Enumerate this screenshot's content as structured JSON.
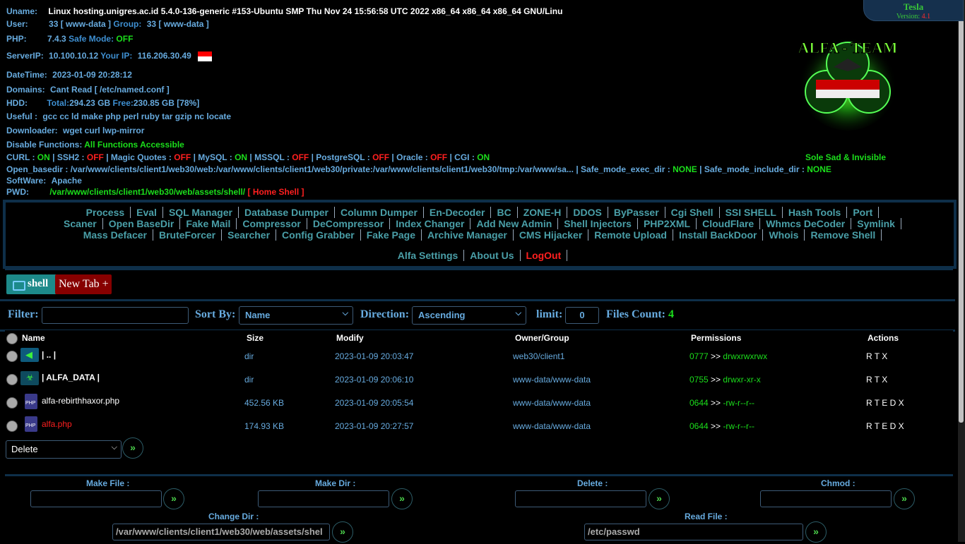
{
  "info": {
    "uname_label": "Uname:",
    "uname": "Linux hosting.unigres.ac.id 5.4.0-136-generic #153-Ubuntu SMP Thu Nov 24 15:56:58 UTC 2022 x86_64 x86_64 x86_64 GNU/Linu",
    "user_label": "User:",
    "user": "33 [ www-data ]",
    "group_label": "Group:",
    "group": "33 [ www-data ]",
    "php_label": "PHP:",
    "php": "7.4.3",
    "safe_mode_label": "Safe Mode:",
    "safe_mode": "OFF",
    "serverip_label": "ServerIP:",
    "serverip": "10.100.10.12",
    "yourip_label": "Your IP:",
    "yourip": "116.206.30.49",
    "datetime_label": "DateTime:",
    "datetime": "2023-01-09 20:28:12",
    "domains_label": "Domains:",
    "domains": "Cant Read [ /etc/named.conf ]",
    "hdd_label": "HDD:",
    "hdd_total_label": "Total:",
    "hdd_total": "294.23 GB",
    "hdd_free_label": "Free:",
    "hdd_free": "230.85 GB [78%]",
    "useful_label": "Useful :",
    "useful": "gcc cc ld make php perl ruby tar gzip nc locate",
    "downloader_label": "Downloader:",
    "downloader": "wget curl lwp-mirror",
    "disable_label": "Disable Functions:",
    "disable": "All Functions Accessible",
    "features": [
      {
        "name": "CURL",
        "state": "ON"
      },
      {
        "name": "SSH2",
        "state": "OFF"
      },
      {
        "name": "Magic Quotes",
        "state": "OFF"
      },
      {
        "name": "MySQL",
        "state": "ON"
      },
      {
        "name": "MSSQL",
        "state": "OFF"
      },
      {
        "name": "PostgreSQL",
        "state": "OFF"
      },
      {
        "name": "Oracle",
        "state": "OFF"
      },
      {
        "name": "CGI",
        "state": "ON"
      }
    ],
    "openbasedir_label": "Open_basedir :",
    "openbasedir": "/var/www/clients/client1/web30/web:/var/www/clients/client1/web30/private:/var/www/clients/client1/web30/tmp:/var/www/sa...",
    "safe_exec_label": "Safe_mode_exec_dir :",
    "safe_exec": "NONE",
    "safe_include_label": "Safe_mode_include_dir :",
    "safe_include": "NONE",
    "software_label": "SoftWare:",
    "software": "Apache",
    "pwd_label": "PWD:",
    "pwd": "/var/www/clients/client1/web30/web/assets/shell/",
    "home_shell": "[ Home Shell ]"
  },
  "badge": {
    "name": "Tesla",
    "version_label": "Version:",
    "version": "4.1"
  },
  "logo_text": "ALFA - TEAM",
  "slogan": "Sole Sad & Invisible",
  "menu": {
    "line1": [
      "Process",
      "Eval",
      "SQL Manager",
      "Database Dumper",
      "Column Dumper",
      "En-Decoder",
      "BC",
      "ZONE-H",
      "DDOS",
      "ByPasser",
      "Cgi Shell",
      "SSI SHELL",
      "Hash Tools",
      "Port"
    ],
    "line2": [
      "Scaner",
      "Open BaseDir",
      "Fake Mail",
      "Compressor",
      "DeCompressor",
      "Index Changer",
      "Add New Admin",
      "Shell Injectors",
      "PHP2XML",
      "CloudFlare",
      "Whmcs DeCoder",
      "Symlink"
    ],
    "line3": [
      "Mass Defacer",
      "BruteForcer",
      "Searcher",
      "Config Grabber",
      "Fake Page",
      "Archive Manager",
      "CMS Hijacker",
      "Remote Upload",
      "Install BackDoor",
      "Whois",
      "Remove Shell"
    ],
    "line4": [
      "Alfa Settings",
      "About Us"
    ],
    "logout": "LogOut"
  },
  "tabs": {
    "current": "shell",
    "new_tab": "New Tab +"
  },
  "filterbar": {
    "filter_label": "Filter:",
    "sort_label": "Sort By:",
    "sort_value": "Name",
    "direction_label": "Direction:",
    "direction_value": "Ascending",
    "limit_label": "limit:",
    "limit_value": "0",
    "count_label": "Files Count:",
    "count": "4"
  },
  "table": {
    "headers": [
      "Name",
      "Size",
      "Modify",
      "Owner/Group",
      "Permissions",
      "Actions"
    ],
    "rows": [
      {
        "name": "| .. |",
        "size": "dir",
        "modify": "2023-01-09 20:03:47",
        "owner": "web30/client1",
        "perm_num": "0777",
        "perm_sep": ">>",
        "perm_str": "drwxrwxrwx",
        "actions": "R T X"
      },
      {
        "name": "| ALFA_DATA |",
        "size": "dir",
        "modify": "2023-01-09 20:06:10",
        "owner": "www-data/www-data",
        "perm_num": "0755",
        "perm_sep": ">>",
        "perm_str": "drwxr-xr-x",
        "actions": "R T X"
      },
      {
        "name": "alfa-rebirthhaxor.php",
        "size": "452.56 KB",
        "modify": "2023-01-09 20:05:54",
        "owner": "www-data/www-data",
        "perm_num": "0644",
        "perm_sep": ">>",
        "perm_str": "-rw-r--r--",
        "actions": "R T E D X"
      },
      {
        "name": "alfa.php",
        "size": "174.93 KB",
        "modify": "2023-01-09 20:27:57",
        "owner": "www-data/www-data",
        "perm_num": "0644",
        "perm_sep": ">>",
        "perm_str": "-rw-r--r--",
        "actions": "R T E D X"
      }
    ],
    "bulk_action": "Delete"
  },
  "bottom": {
    "make_file_label": "Make File :",
    "make_dir_label": "Make Dir :",
    "delete_label": "Delete :",
    "chmod_label": "Chmod :",
    "change_dir_label": "Change Dir :",
    "change_dir_value": "/var/www/clients/client1/web30/web/assets/shel",
    "read_file_label": "Read File :",
    "read_file_value": "/etc/passwd"
  },
  "colors": {
    "accent_green": "#1bde1b",
    "accent_red": "#ff1f1f",
    "label_blue": "#67abdf",
    "menu_teal": "#4a9fa8",
    "border": "#0e2f49"
  }
}
